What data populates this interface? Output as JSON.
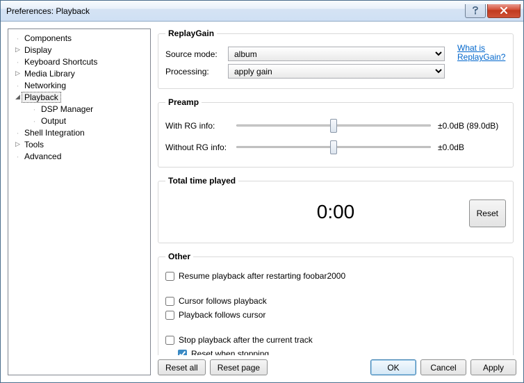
{
  "window": {
    "title": "Preferences: Playback"
  },
  "tree": {
    "items": [
      {
        "label": "Components",
        "type": "leaf"
      },
      {
        "label": "Display",
        "type": "node"
      },
      {
        "label": "Keyboard Shortcuts",
        "type": "leaf"
      },
      {
        "label": "Media Library",
        "type": "node"
      },
      {
        "label": "Networking",
        "type": "leaf"
      },
      {
        "label": "Playback",
        "type": "node",
        "expanded": true,
        "selected": true
      },
      {
        "label": "DSP Manager",
        "type": "child"
      },
      {
        "label": "Output",
        "type": "child"
      },
      {
        "label": "Shell Integration",
        "type": "leaf"
      },
      {
        "label": "Tools",
        "type": "node"
      },
      {
        "label": "Advanced",
        "type": "leaf"
      }
    ]
  },
  "replaygain": {
    "legend": "ReplayGain",
    "source_label": "Source mode:",
    "source_value": "album",
    "processing_label": "Processing:",
    "processing_value": "apply gain",
    "link_line1": "What is",
    "link_line2": "ReplayGain?"
  },
  "preamp": {
    "legend": "Preamp",
    "with_label": "With RG info:",
    "with_value": "±0.0dB (89.0dB)",
    "without_label": "Without RG info:",
    "without_value": "±0.0dB"
  },
  "total": {
    "legend": "Total time played",
    "value": "0:00",
    "reset": "Reset"
  },
  "other": {
    "legend": "Other",
    "resume": "Resume playback after restarting foobar2000",
    "cursor_follows": "Cursor follows playback",
    "playback_follows": "Playback follows cursor",
    "stop_after": "Stop playback after the current track",
    "reset_stop": "Reset when stopping"
  },
  "footer": {
    "reset_all": "Reset all",
    "reset_page": "Reset page",
    "ok": "OK",
    "cancel": "Cancel",
    "apply": "Apply"
  }
}
